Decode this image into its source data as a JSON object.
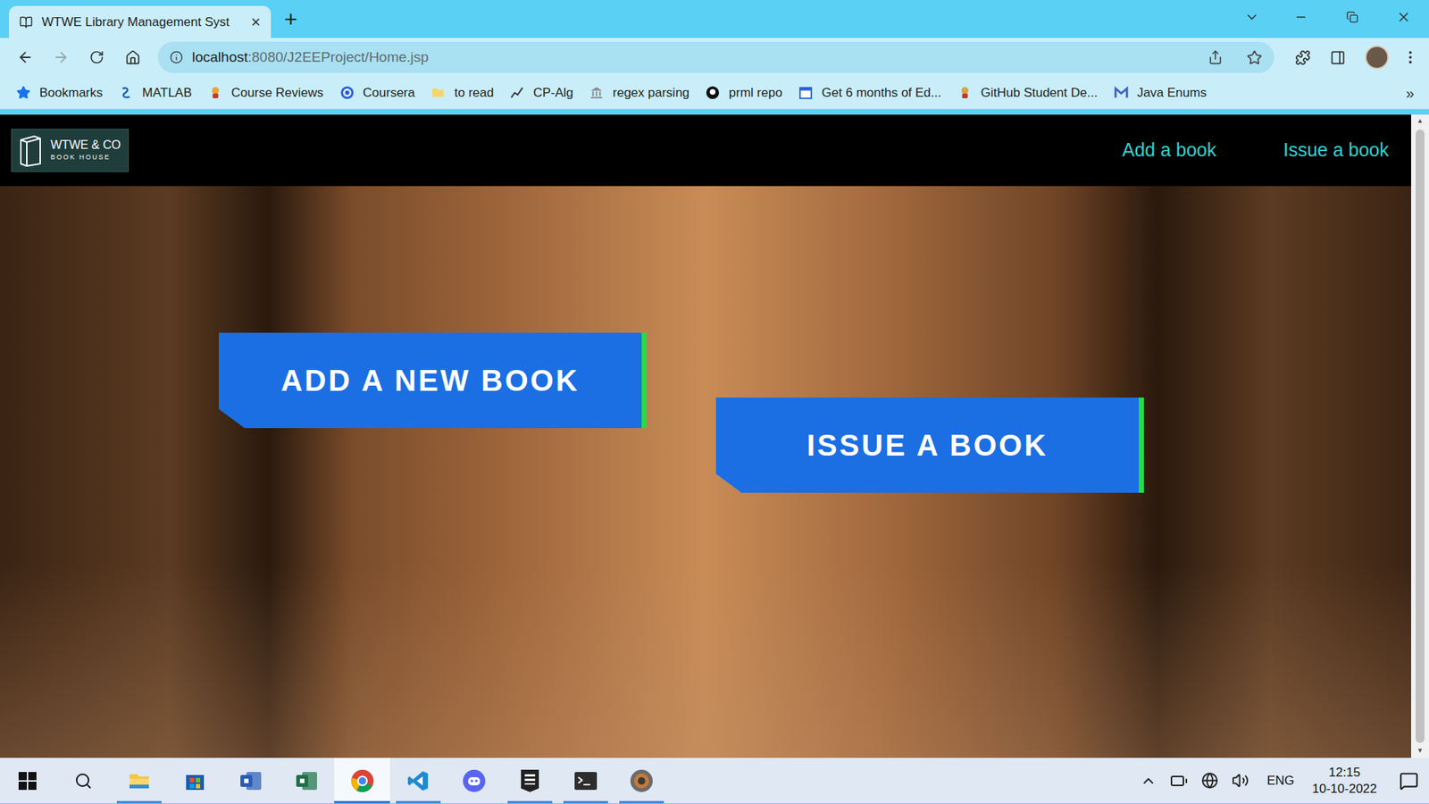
{
  "browser": {
    "tabs": [
      {
        "title": "WTWE Library Management Syst",
        "close": "×",
        "selected": true
      }
    ],
    "new_tab": "+",
    "address": {
      "host": "localhost",
      "path": ":8080/J2EEProject/Home.jsp"
    },
    "bookmarks": [
      {
        "label": "Bookmarks",
        "kind": "star"
      },
      {
        "label": "MATLAB",
        "kind": "matlab"
      },
      {
        "label": "Course Reviews",
        "kind": "reviews"
      },
      {
        "label": "Coursera",
        "kind": "coursera"
      },
      {
        "label": "to read",
        "kind": "folder"
      },
      {
        "label": "CP-Alg",
        "kind": "chart"
      },
      {
        "label": "regex parsing",
        "kind": "bank"
      },
      {
        "label": "prml repo",
        "kind": "github"
      },
      {
        "label": "Get 6 months of Ed...",
        "kind": "calendar"
      },
      {
        "label": "GitHub Student De...",
        "kind": "student"
      },
      {
        "label": "Java Enums",
        "kind": "gmail"
      }
    ],
    "more_bookmarks": "»"
  },
  "page": {
    "logo": {
      "title": "WTWE & CO",
      "subtitle": "BOOK HOUSE"
    },
    "nav": [
      "Add a book",
      "Issue a book"
    ],
    "actions": [
      "ADD A NEW BOOK",
      "ISSUE A BOOK"
    ]
  },
  "taskbar": {
    "apps": [
      {
        "kind": "explorer",
        "running": true,
        "selected": false
      },
      {
        "kind": "store",
        "running": false,
        "selected": false
      },
      {
        "kind": "word",
        "running": false,
        "selected": false
      },
      {
        "kind": "excel",
        "running": false,
        "selected": false
      },
      {
        "kind": "chrome",
        "running": true,
        "selected": true
      },
      {
        "kind": "vscode",
        "running": true,
        "selected": false
      },
      {
        "kind": "discord",
        "running": false,
        "selected": false
      },
      {
        "kind": "epic",
        "running": true,
        "selected": false
      },
      {
        "kind": "terminal",
        "running": true,
        "selected": false
      },
      {
        "kind": "game",
        "running": true,
        "selected": false
      }
    ],
    "language": "ENG",
    "time": "12:15",
    "date": "10-10-2022"
  }
}
